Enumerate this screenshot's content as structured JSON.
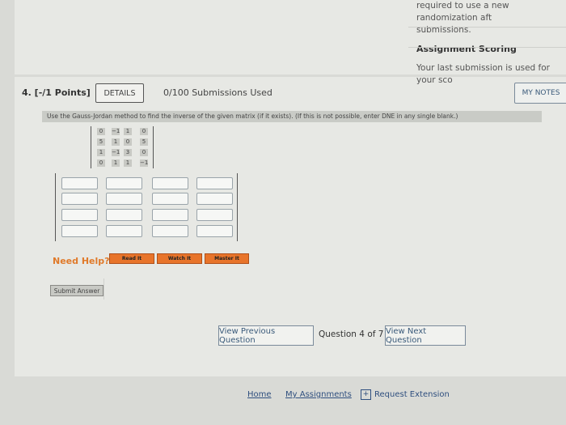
{
  "top": {
    "line1": "required to use a new randomization aft",
    "line2": "submissions.",
    "scoring_title": "Assignment Scoring",
    "scoring_text": "Your last submission is used for your sco"
  },
  "question": {
    "header": "4. [-/1 Points]",
    "details_label": "DETAILS",
    "submissions": "0/100 Submissions Used",
    "my_notes_label": "MY NOTES",
    "prompt": "Use the Gauss-Jordan method to find the inverse of the given matrix (if it exists). (If this is not possible, enter DNE in any single blank.)",
    "matrix": [
      [
        "0",
        "−1",
        "1",
        "0"
      ],
      [
        "5",
        "1",
        "0",
        "5"
      ],
      [
        "1",
        "−1",
        "3",
        "0"
      ],
      [
        "0",
        "1",
        "1",
        "−1"
      ]
    ]
  },
  "help": {
    "label": "Need Help?",
    "read_it": "Read It",
    "watch_it": "Watch It",
    "master_it": "Master It"
  },
  "submit_label": "Submit Answer",
  "nav": {
    "prev": "View Previous Question",
    "position": "Question 4 of 7",
    "next": "View Next Question"
  },
  "footer": {
    "home": "Home",
    "my_assignments": "My Assignments",
    "request_extension": "Request Extension"
  },
  "colors": {
    "accent_orange": "#e8742a",
    "link_blue": "#2f4f7f"
  }
}
